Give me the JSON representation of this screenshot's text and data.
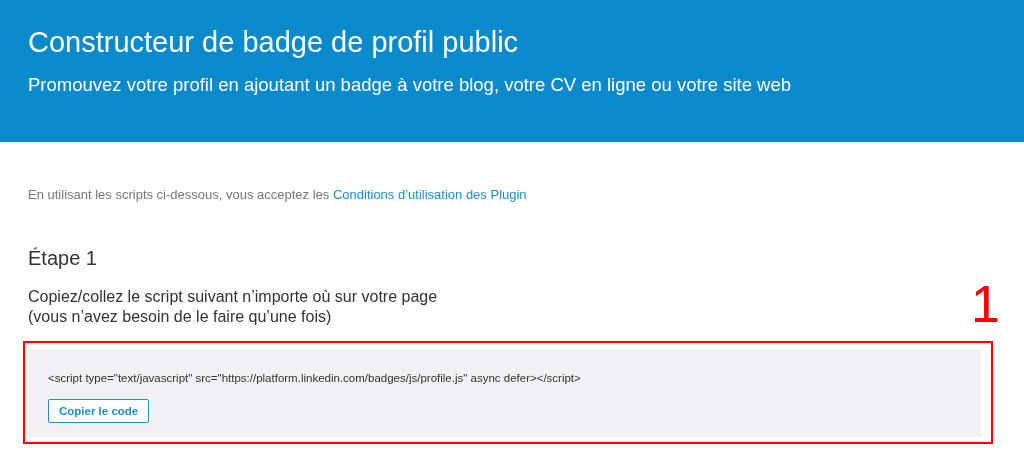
{
  "header": {
    "title": "Constructeur de badge de profil public",
    "subtitle": "Promouvez votre profil en ajoutant un badge à votre blog, votre CV en ligne ou votre site web"
  },
  "terms": {
    "text": "En utilisant les scripts ci-dessous, vous acceptez les ",
    "link": "Conditions d’utilisation des Plugin"
  },
  "step": {
    "title": "Étape 1",
    "instructions": [
      "Copiez/collez le script suivant n’importe où sur votre page",
      "(vous n’avez besoin de le faire qu’une fois)"
    ],
    "code": "<script type=\"text/javascript\" src=\"https://platform.linkedin.com/badges/js/profile.js\" async defer></script>",
    "button": "Copier le code"
  },
  "annotation": {
    "label": "1"
  }
}
